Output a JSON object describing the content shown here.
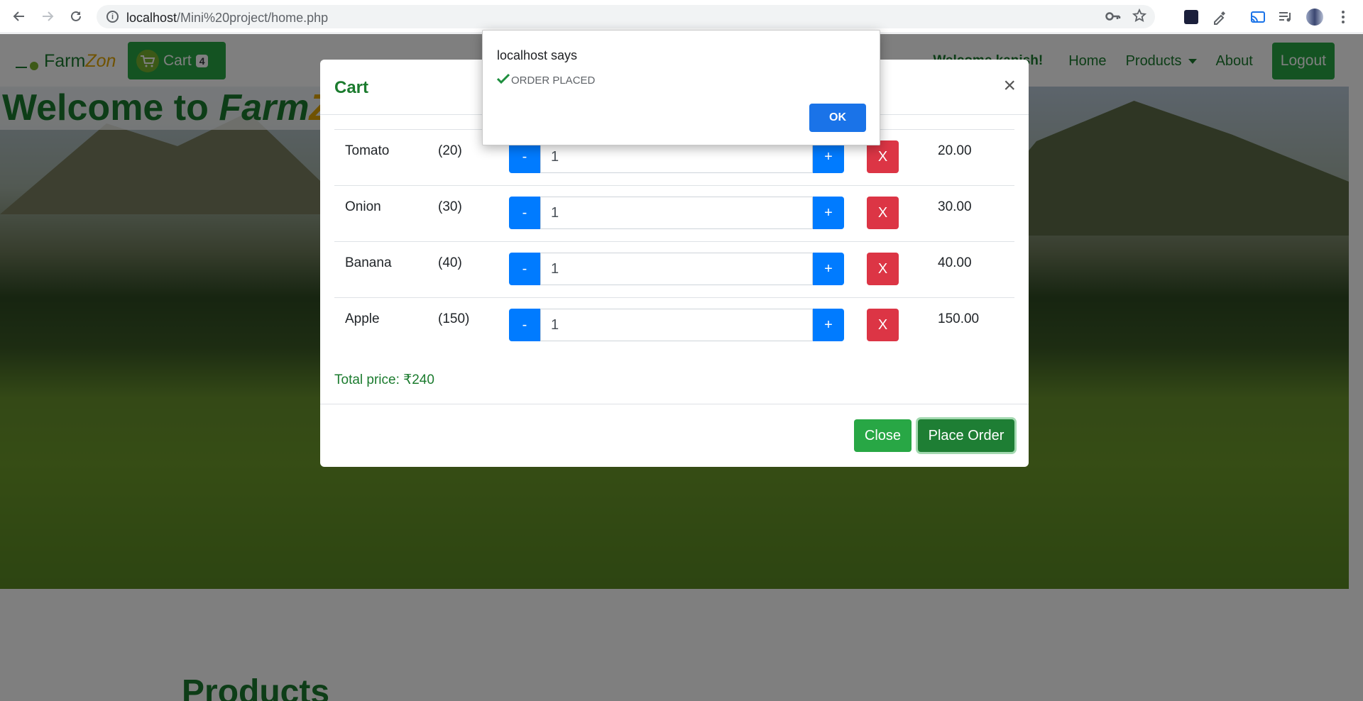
{
  "browser": {
    "url_host": "localhost",
    "url_path": "/Mini%20project/home.php"
  },
  "navbar": {
    "brand_farm": "Farm",
    "brand_zon": "Zon",
    "cart_label": "Cart",
    "cart_count": "4",
    "welcome": "Welcome kanish!",
    "links": [
      "Home",
      "Products",
      "About"
    ],
    "logout_label": "Logout"
  },
  "hero": {
    "title_prefix": "Welcome to ",
    "title_farm": "Farm",
    "title_zon": "Zon"
  },
  "products_heading": "Products",
  "modal": {
    "title": "Cart",
    "close_symbol": "×",
    "items": [
      {
        "name": "Tomato",
        "price": "(20)",
        "qty": "1",
        "total": "20.00"
      },
      {
        "name": "Onion",
        "price": "(30)",
        "qty": "1",
        "total": "30.00"
      },
      {
        "name": "Banana",
        "price": "(40)",
        "qty": "1",
        "total": "40.00"
      },
      {
        "name": "Apple",
        "price": "(150)",
        "qty": "1",
        "total": "150.00"
      }
    ],
    "minus_label": "-",
    "plus_label": "+",
    "remove_label": "X",
    "total_price": "Total price: ₹240",
    "close_label": "Close",
    "place_order_label": "Place Order"
  },
  "alert": {
    "title": "localhost says",
    "message": "ORDER PLACED",
    "ok_label": "OK"
  },
  "colors": {
    "brand_green": "#1b7b2e",
    "button_green": "#28a745",
    "accent_yellow": "#e0a500",
    "primary_blue": "#007bff",
    "danger_red": "#dc3545",
    "chrome_blue": "#1a73e8"
  }
}
